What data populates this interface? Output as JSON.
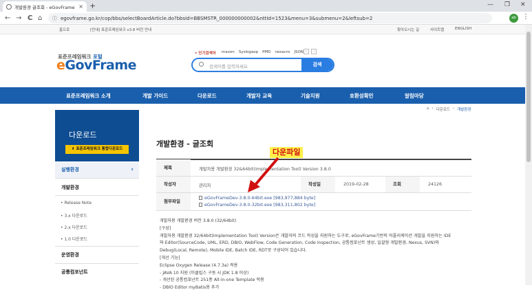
{
  "browser": {
    "tab_title": "개발환경 글조회 - eGovFrame 표준프레임워크 포털",
    "tab_close": "×",
    "new_tab": "+",
    "window_controls": [
      "—",
      "❐",
      "✕"
    ],
    "nav": [
      "←",
      "→",
      "C",
      "⌂"
    ],
    "url": "egovframe.go.kr/cop/bbs/selectBoardArticle.do?bbsId=BBSMSTR_000000000002&nttId=1523&menu=3&submenu=2&leftsub=2",
    "profile_text": "ab",
    "menu_icon": "⋮"
  },
  "util_bar": {
    "home": "홈으로",
    "notice": "[안내] 표준프레임워크 v3.8 버전 안내",
    "links": [
      "찾아오시는 길",
      "사이트맵",
      "ENGLISH"
    ]
  },
  "header": {
    "logo_small_prefix": "표준프레임워크",
    "logo_small_suffix": "포털",
    "logo_e": "e",
    "logo_rest": "GovFrame",
    "keyword_label": "• 인기검색어",
    "keywords": [
      "maven",
      "Syslogaop",
      "PMD",
      "nexacro",
      "JSON"
    ],
    "kw_prev": "‹",
    "kw_next": "›",
    "search_placeholder": "검색어를 입력하세요",
    "search_button": "검색"
  },
  "gnb": [
    "표준프레임워크 소개",
    "개발 가이드",
    "다운로드",
    "개발자 교육",
    "기술지원",
    "호환성확인",
    "알림마당"
  ],
  "breadcrumb": {
    "home": "⌂",
    "sep": "›",
    "items": [
      "다운로드",
      "개발환경"
    ]
  },
  "sidebar": {
    "title": "다운로드",
    "download_btn": "표준프레임워크 통합다운로드",
    "download_icon": "⬇",
    "items": [
      "실행환경",
      "개발환경",
      "운영환경",
      "공통컴포넌트"
    ],
    "sub_items": [
      "Release Note",
      "3.x 다운로드",
      "2.x 다운로드",
      "1.0 다운로드"
    ],
    "arrow": "›"
  },
  "article": {
    "page_title": "개발환경 - 글조회",
    "labels": {
      "subject": "제목",
      "writer": "작성자",
      "date": "작성일",
      "views": "조회",
      "attach": "첨부파일"
    },
    "subject": "개발자용 개발환경 32&64bit(Implementation Tool) Version 3.8.0",
    "writer": "관리자",
    "date": "2019-02-28",
    "views": "24126",
    "files": [
      "eGovFrameDev-3.8.0-64bit.exe [983,977,884 byte]",
      "eGovFrameDev-3.8.0-32bit.exe [983,311,802 byte]"
    ],
    "body": [
      "개발자용 개발환경 버전 3.8.0 (32/64bit)",
      "[구성]",
      "개발자용 개발환경 32/64bit(Implementation Tool) Version은 개발자의 코드 작성을 지원하는 도구로, eGovFrame기반의 어플리케이션 개발을 지원하는 IDE",
      "와 Editor(SourceCode, UML, ERD, DBIO, WebFlow, Code Generation, Code Inspection, 공통컴포넌트 생성, 일괄형 개발환경, Nexus, SVN)와",
      "Debug(Local, Remote), Mobile IDE, Batch IDE, RDT로 구성되어 있습니다.",
      "[개선 기능]",
      "Eclipse Oxygen Release (4.7.3a) 적용",
      "- JAVA 10 지원 (이클립스 구동 시 JDK 1.8 이상)",
      "- 개선된 공통컴포넌트 251종 All-in-one Template 적용",
      "- DBIO Editor myBatis용 추가"
    ]
  },
  "annotation": {
    "label": "다운파일",
    "color": "#d01010"
  }
}
